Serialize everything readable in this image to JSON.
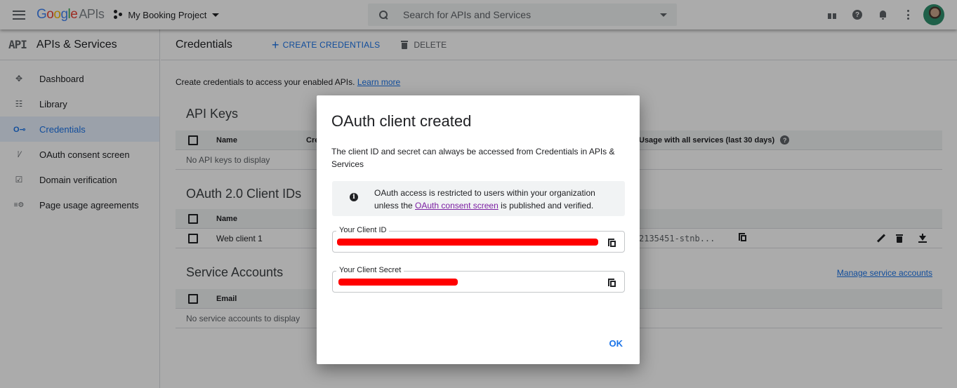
{
  "topbar": {
    "logo_google": "Google",
    "logo_apis": "APIs",
    "project_name": "My Booking Project",
    "search_placeholder": "Search for APIs and Services",
    "icons": [
      "menu-icon",
      "project-icon",
      "search-icon",
      "gift-icon",
      "help-icon",
      "notifications-icon",
      "more-vert-icon",
      "avatar"
    ]
  },
  "sidebar": {
    "logo": "API",
    "title": "APIs & Services",
    "items": [
      {
        "label": "Dashboard",
        "icon": "dashboard-icon",
        "glyph": "✥",
        "active": false
      },
      {
        "label": "Library",
        "icon": "library-icon",
        "glyph": "⵿",
        "active": false
      },
      {
        "label": "Credentials",
        "icon": "key-icon",
        "glyph": "O⊸",
        "active": true
      },
      {
        "label": "OAuth consent screen",
        "icon": "consent-icon",
        "glyph": "⁞⁄",
        "active": false
      },
      {
        "label": "Domain verification",
        "icon": "domain-check-icon",
        "glyph": "☑",
        "active": false
      },
      {
        "label": "Page usage agreements",
        "icon": "settings-list-icon",
        "glyph": "≡⚙",
        "active": false
      }
    ]
  },
  "main": {
    "page_title": "Credentials",
    "create_label": "CREATE CREDENTIALS",
    "delete_label": "DELETE",
    "intro_text": "Create credentials to access your enabled APIs.",
    "learn_more": "Learn more",
    "api_keys": {
      "title": "API Keys",
      "col_name": "Name",
      "col_created_partial": "Cre",
      "col_usage": "Usage with all services (last 30 days)",
      "empty": "No API keys to display"
    },
    "oauth": {
      "title": "OAuth 2.0 Client IDs",
      "col_name": "Name",
      "rows": [
        {
          "name": "Web client 1",
          "client_id": "2135451-stnb..."
        }
      ]
    },
    "service_accounts": {
      "title": "Service Accounts",
      "manage_link": "Manage service accounts",
      "col_email": "Email",
      "empty": "No service accounts to display"
    }
  },
  "dialog": {
    "title": "OAuth client created",
    "description": "The client ID and secret can always be accessed from Credentials in APIs & Services",
    "info_pre": "OAuth access is restricted to users within your organization unless the",
    "info_link": "OAuth consent screen",
    "info_post": "is published and verified.",
    "client_id_label": "Your Client ID",
    "client_secret_label": "Your Client Secret",
    "ok_label": "OK"
  },
  "colors": {
    "accent": "#1a73e8",
    "link_visited": "#7b1fa2",
    "redaction": "#ff0000"
  }
}
